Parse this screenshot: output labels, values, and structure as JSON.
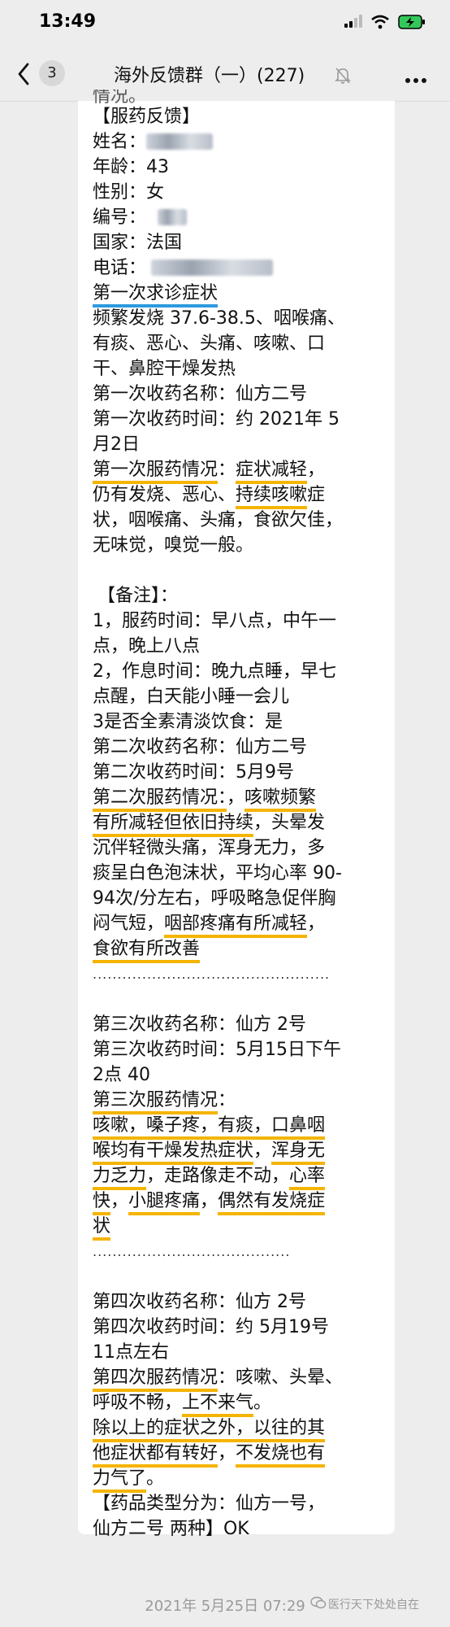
{
  "status_bar": {
    "time": "13:49"
  },
  "header": {
    "back_count": "3",
    "title": "海外反馈群（一）(227)"
  },
  "message": {
    "partial_line": "情况。",
    "section_title": "【服药反馈】",
    "name_label": "姓名：",
    "age_label": "年龄：",
    "age_value": "43",
    "gender_label": "性别：",
    "gender_value": "女",
    "id_label": "编号：",
    "country_label": "国家：",
    "country_value": "法国",
    "phone_label": "电话：",
    "first_visit_title": "第一次求诊症状",
    "first_visit_lines": [
      " 频繁发烧 37.6-38.5、咽喉痛、",
      "有痰、恶心、头痛、咳嗽、口",
      "干、鼻腔干燥发热"
    ],
    "first_med_name": "第一次收药名称：仙方二号",
    "first_med_time_1": "第一次收药时间：约 2021年 5",
    "first_med_time_2": "月2日",
    "first_effect_label": "第一次服药情况",
    "first_effect_colon": "：",
    "first_effect_hl": "症状减轻",
    "first_effect_rest": "，",
    "first_effect_line2_a": "仍有发烧、恶心、",
    "first_effect_line2_hl": "持续咳嗽",
    "first_effect_line2_b": "症",
    "first_effect_line3": "状，咽喉痛、头痛，食欲欠佳，",
    "first_effect_line4": "无味觉，嗅觉一般。",
    "notes_title": "【备注】：",
    "notes_lines": [
      "1，服药时间：早八点，中午一",
      "点，晚上八点",
      "2，作息时间：晚九点睡，早七",
      "点醒，白天能小睡一会儿",
      "3是否全素清淡饮食：是"
    ],
    "second_med_name": "第二次收药名称：仙方二号",
    "second_med_time": "第二次收药时间：5月9号",
    "second_effect_label": "第二次服药情况：",
    "second_effect_a": "，",
    "second_effect_hl1": "咳嗽频繁",
    "second_effect_line2_hl": "有所减轻但依旧持续",
    "second_effect_line2_b": "，头晕发",
    "second_effect_line3": "沉伴轻微头痛，浑身无力，多",
    "second_effect_line4": "痰呈白色泡沫状，平均心率 90-",
    "second_effect_line5": "94次/分左右，呼吸略急促伴胸",
    "second_effect_line6_a": "闷气短，",
    "second_effect_line6_hl": "咽部疼痛有所减轻",
    "second_effect_line6_b": "，",
    "second_effect_line7_hl": "食欲有所改善",
    "dots": "................................................",
    "third_med_name": "第三次收药名称：仙方 2号",
    "third_med_time_1": "第三次收药时间：5月15日下午",
    "third_med_time_2": "2点 40",
    "third_effect_label": "第三次服药情况",
    "third_effect_colon": "：",
    "third_line1_hl1": " 咳嗽，",
    "third_line1_hl2": "嗓子疼，",
    "third_line1_hl3": "有痰，",
    "third_line1_hl4": "口鼻咽",
    "third_line2_hl1": "喉均有干燥发热症状",
    "third_line2_b": "，",
    "third_line2_hl2": "浑身无",
    "third_line3_hl1": "力乏力",
    "third_line3_b": "，走路像走不动，",
    "third_line3_hl2": "心率",
    "third_line4_hl1": "快",
    "third_line4_b": "，",
    "third_line4_hl2": "小腿疼痛",
    "third_line4_c": "，",
    "third_line4_hl3": "偶然有发烧症",
    "third_line5_hl": "状",
    "dots2": "........................................",
    "fourth_med_name": "第四次收药名称：仙方 2号",
    "fourth_med_time_1": "第四次收药时间：约 5月19号",
    "fourth_med_time_2": "11点左右",
    "fourth_effect_label": "第四次服药情况",
    "fourth_effect_rest": "：咳嗽、头晕、",
    "fourth_line2_a": "呼吸不畅，",
    "fourth_line2_hl": "上不来气",
    "fourth_line2_b": "。",
    "fourth_line3_hl": "除以上的症状之外，以往的其",
    "fourth_line4_hl1": "他症状都有转好",
    "fourth_line4_b": "，",
    "fourth_line4_hl2": "不发烧也有",
    "fourth_line5_hl": "力气了",
    "fourth_line5_b": "。",
    "types_line1": "【药品类型分为：仙方一号，",
    "types_line2": "仙方二号  两种】OK"
  },
  "footer": {
    "timestamp": "2021年 5月25日 07:29",
    "watermark": "医行天下处处自在"
  },
  "colors": {
    "highlight_yellow": "#f4b400",
    "highlight_blue": "#2d9ae0",
    "bubble": "#ffffff",
    "background": "#ededed"
  },
  "icons": [
    "signal-icon",
    "wifi-icon",
    "battery-charging-icon",
    "back-chevron-icon",
    "mute-bell-icon",
    "more-dots-icon",
    "wechat-watermark-icon"
  ]
}
